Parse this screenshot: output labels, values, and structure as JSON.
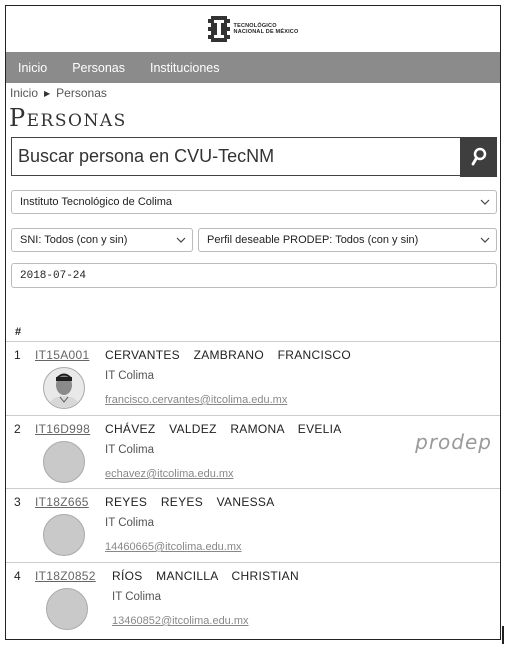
{
  "header": {
    "logo_line1": "TECNOLÓGICO",
    "logo_line2": "NACIONAL DE MÉXICO",
    "logo_icon": "gear-logo-icon"
  },
  "nav": {
    "items": [
      "Inicio",
      "Personas",
      "Instituciones"
    ]
  },
  "breadcrumb": {
    "home": "Inicio",
    "current": "Personas",
    "separator_icon": "triangle-right-icon"
  },
  "page_title": "Personas",
  "search": {
    "placeholder": "Buscar persona en CVU-TecNM",
    "button_icon": "search-icon"
  },
  "filters": {
    "institution": "Instituto Tecnológico de Colima",
    "sni": "SNI: Todos (con y sin)",
    "prodep": "Perfil deseable PRODEP: Todos (con y sin)",
    "date": "2018-07-24"
  },
  "table": {
    "header": "#",
    "rows": [
      {
        "num": "1",
        "cvu": "IT15A001",
        "name": "CERVANTES ZAMBRANO FRANCISCO",
        "institution": "IT Colima",
        "email": "francisco.cervantes@itcolima.edu.mx",
        "avatar": "photo",
        "badge": ""
      },
      {
        "num": "2",
        "cvu": "IT16D998",
        "name": "CHÁVEZ VALDEZ RAMONA EVELIA",
        "institution": "IT Colima",
        "email": "echavez@itcolima.edu.mx",
        "avatar": "placeholder",
        "badge": "prodep"
      },
      {
        "num": "3",
        "cvu": "IT18Z665",
        "name": "REYES REYES VANESSA",
        "institution": "IT Colima",
        "email": "14460665@itcolima.edu.mx",
        "avatar": "placeholder",
        "badge": ""
      },
      {
        "num": "4",
        "cvu": "IT18Z0852",
        "name": "RÍOS MANCILLA CHRISTIAN",
        "institution": "IT Colima",
        "email": "13460852@itcolima.edu.mx",
        "avatar": "placeholder",
        "badge": ""
      }
    ]
  }
}
